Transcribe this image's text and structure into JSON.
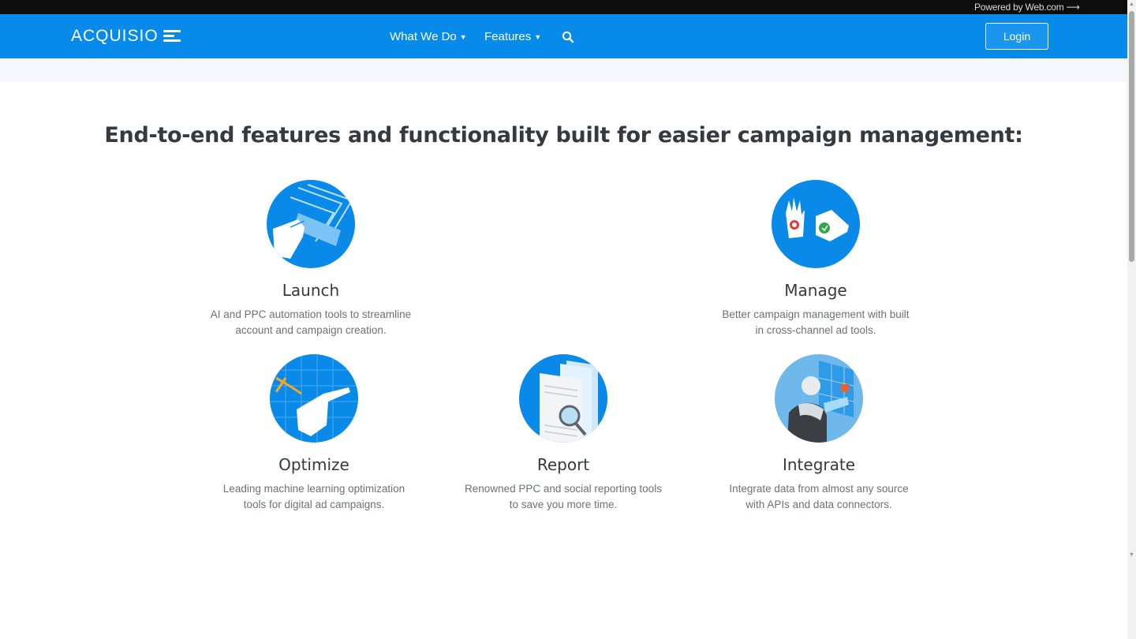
{
  "topbar": {
    "powered_by": "Powered by Web.com ⟶"
  },
  "header": {
    "logo_text": "ACQUISIO",
    "nav": [
      {
        "label": "What We Do"
      },
      {
        "label": "Features"
      }
    ],
    "login_label": "Login"
  },
  "main": {
    "headline": "End-to-end features and functionality built for easier campaign management:",
    "features": [
      {
        "title": "Launch",
        "description_line1": "AI and PPC automation tools to streamline",
        "description_line2": "account and campaign creation."
      },
      {
        "title": "Manage",
        "description_line1": "Better campaign management with built",
        "description_line2": "in cross-channel ad tools."
      },
      {
        "title": "Optimize",
        "description_line1": "Leading machine learning optimization",
        "description_line2": "tools for digital ad campaigns."
      },
      {
        "title": "Report",
        "description_line1": "Renowned PPC and social reporting tools",
        "description_line2": "to save you more time."
      },
      {
        "title": "Integrate",
        "description_line1": "Integrate data from almost any source",
        "description_line2": "with APIs and data connectors."
      }
    ]
  },
  "colors": {
    "brand_blue": "#078bea",
    "topbar": "#0d0d0d",
    "heading": "#333a40",
    "body_text": "#6c7278"
  },
  "icons": [
    "search-icon",
    "chevron-down-icon",
    "launch-icon",
    "manage-icon",
    "optimize-icon",
    "report-icon",
    "integrate-icon"
  ]
}
